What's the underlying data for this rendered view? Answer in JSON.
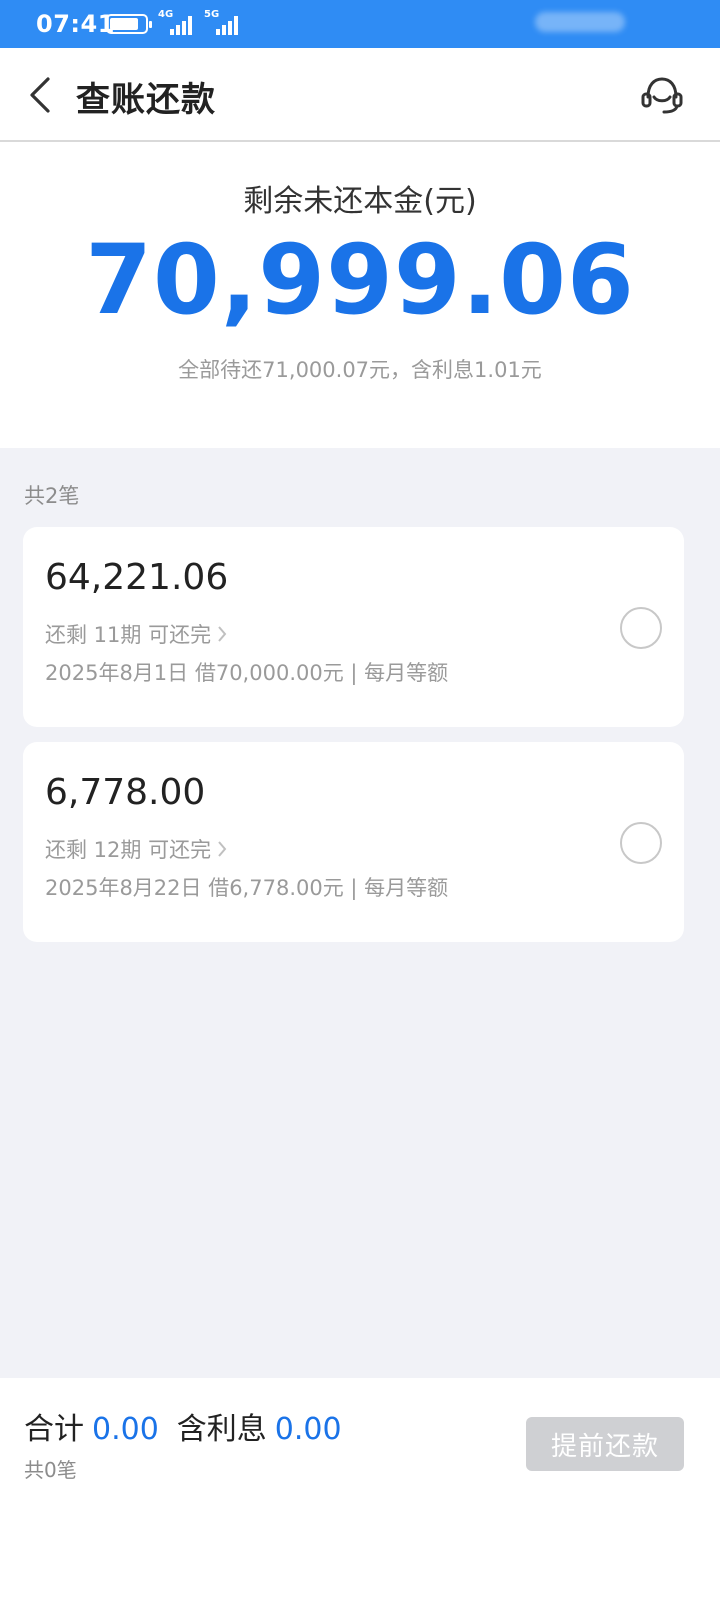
{
  "status_bar": {
    "time": "07:41",
    "network_1": "4G",
    "network_2": "5G",
    "icons": [
      "battery-icon",
      "signal-icon",
      "signal-icon"
    ]
  },
  "nav": {
    "back_icon": "chevron-left-icon",
    "title": "查账还款",
    "service_icon": "customer-service-icon"
  },
  "summary": {
    "label": "剩余未还本金(元)",
    "amount": "70,999.06",
    "sub_text": "全部待还71,000.07元，含利息1.01元"
  },
  "count_label": "共2笔",
  "loans": [
    {
      "amount": "64,221.06",
      "remaining": "还剩 11期 可还完",
      "detail": "2025年8月1日 借70,000.00元 | 每月等额"
    },
    {
      "amount": "6,778.00",
      "remaining": "还剩 12期 可还完",
      "detail": "2025年8月22日 借6,778.00元 | 每月等额"
    }
  ],
  "footer": {
    "total_label": "合计",
    "total_value": "0.00",
    "interest_label": "含利息",
    "interest_value": "0.00",
    "selected_count": "共0笔",
    "prepay_button": "提前还款"
  },
  "colors": {
    "accent": "#1a73e8",
    "status_bar": "#2f8cf4",
    "background": "#f1f2f7",
    "button_disabled": "#cfd0d3"
  }
}
